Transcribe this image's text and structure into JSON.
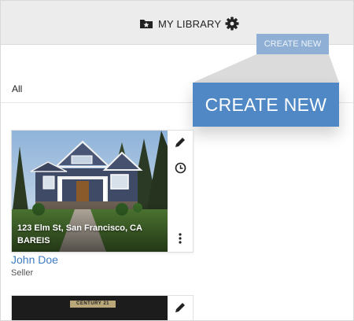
{
  "header": {
    "library_label": "MY LIBRARY",
    "library_icon": "folder-star-icon",
    "settings_icon": "gear-icon",
    "create_label": "CREATE NEW"
  },
  "filter": {
    "label": "All"
  },
  "callout": {
    "label": "CREATE NEW",
    "color": "#4f88c5"
  },
  "listings": [
    {
      "address": "123 Elm St, San Francisco, CA",
      "brand": "BAREIS",
      "agent_name": "John Doe",
      "agent_role": "Seller",
      "actions": [
        "pencil-icon",
        "clock-icon",
        "more-vertical-icon"
      ]
    },
    {
      "brand_banner": "CENTURY 21",
      "actions": [
        "pencil-icon"
      ]
    }
  ],
  "colors": {
    "accent": "#4f88c5",
    "link": "#3d7cc2",
    "topbar": "#ececec"
  }
}
